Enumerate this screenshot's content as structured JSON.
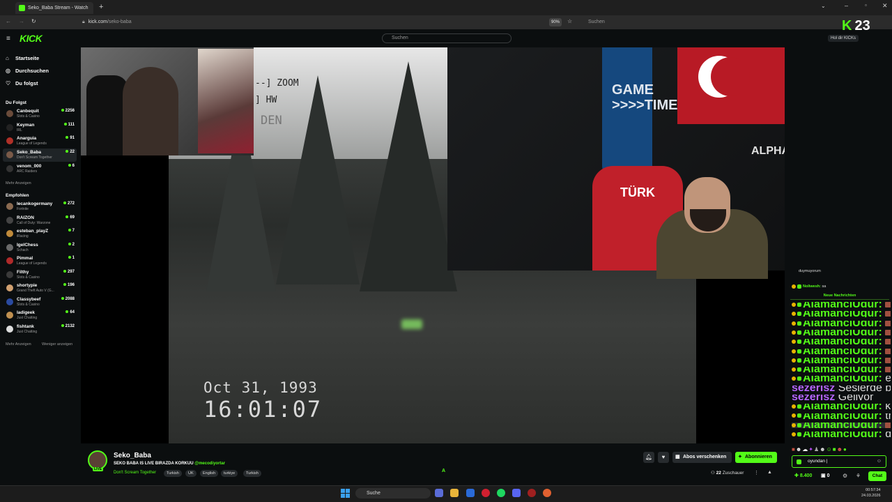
{
  "browser": {
    "tab_title": "Seko_Baba Stream - Watch",
    "url_host": "kick.com",
    "url_path": "/seko-baba",
    "zoom": "90%",
    "search_placeholder": "Suchen"
  },
  "header": {
    "logo": "KICK",
    "search_placeholder": "Suchen",
    "kick_count": "23",
    "kick_letter": "K",
    "hold_kicks": "Hol dir KICKs"
  },
  "sidebar": {
    "nav": [
      {
        "label": "Startseite",
        "icon": "home-icon"
      },
      {
        "label": "Durchsuchen",
        "icon": "compass-icon"
      },
      {
        "label": "Du folgst",
        "icon": "heart-icon"
      }
    ],
    "following_title": "Du Folgst",
    "following": [
      {
        "name": "Canbequit",
        "game": "Slots & Casino",
        "viewers": "2256"
      },
      {
        "name": "Keyman",
        "game": "IRL",
        "viewers": "111"
      },
      {
        "name": "Anarguia",
        "game": "League of Legends",
        "viewers": "91"
      },
      {
        "name": "Seko_Baba",
        "game": "Don't Scream Together",
        "viewers": "22"
      },
      {
        "name": "venom_000",
        "game": "ARC Raiders",
        "viewers": "6"
      }
    ],
    "more_label": "Mehr Anzeigen",
    "recommended_title": "Empfohlen",
    "recommended": [
      {
        "name": "lecankogermany",
        "game": "Fortnite",
        "viewers": "272"
      },
      {
        "name": "RAIZON",
        "game": "Call of Duty: Warzone",
        "viewers": "69"
      },
      {
        "name": "esteban_playZ",
        "game": "iRacing",
        "viewers": "7"
      },
      {
        "name": "IgelChess",
        "game": "Schach",
        "viewers": "2"
      },
      {
        "name": "Pimmal",
        "game": "League of Legends",
        "viewers": "1"
      },
      {
        "name": "Filthy",
        "game": "Slots & Casino",
        "viewers": "297"
      },
      {
        "name": "shortypie",
        "game": "Grand Theft Auto V (G...",
        "viewers": "196"
      },
      {
        "name": "Classybeef",
        "game": "Slots & Casino",
        "viewers": "2088"
      },
      {
        "name": "ladigeek",
        "game": "Just Chatting",
        "viewers": "64"
      },
      {
        "name": "fishtank",
        "game": "Just Chatting",
        "viewers": "2132"
      }
    ],
    "more_label2": "Mehr Anzeigen",
    "less_label": "Weniger anzeigen"
  },
  "video": {
    "vhs_date": "Oct 31, 1993",
    "vhs_time": "16:01:07",
    "vhs_zoom": "--] ZOOM",
    "vhs_hw": "] HW",
    "vhs_den": "DEN",
    "neon_sign": "GAME\n>>>>TIME",
    "wall_sign": "ALPHAWOLF_TTV",
    "shirt_text": "TÜRK"
  },
  "chat": {
    "top_messages": [
      {
        "user": "",
        "text": "duymuyorum"
      },
      {
        "user": "Noliwesh:",
        "text": "sa"
      }
    ],
    "new_messages_label": "Neue Nachrichten",
    "messages": [
      {
        "user": "AlamancıUgur:",
        "text": "",
        "emote": true
      },
      {
        "user": "AlamancıUgur:",
        "text": "",
        "emote": true
      },
      {
        "user": "AlamancıUgur:",
        "text": "",
        "emote": true
      },
      {
        "user": "AlamancıUgur:",
        "text": "",
        "emote": true
      },
      {
        "user": "AlamancıUgur:",
        "text": "",
        "emote": true
      },
      {
        "user": "AlamancıUgur:",
        "text": "",
        "emote": true
      },
      {
        "user": "AlamancıUgur:",
        "text": "",
        "emote": true
      },
      {
        "user": "AlamancıUgur:",
        "text": "",
        "emote": true
      },
      {
        "user": "AlamancıUgur:",
        "text": "evt geliyo",
        "emote": false
      },
      {
        "user": "sezerlsz",
        "text": "Seslerde problem yok",
        "emote": false
      },
      {
        "user": "sezerlsz",
        "text": "Geliyor",
        "emote": false
      },
      {
        "user": "AlamancıUgur:",
        "text": "kimin dc",
        "emote": false
      },
      {
        "user": "AlamancıUgur:",
        "text": "tmm",
        "emote": false
      },
      {
        "user": "AlamancıUgur:",
        "text": "",
        "emote": true
      },
      {
        "user": "AlamancıUgur:",
        "text": "dc gelirsin",
        "emote": false
      }
    ],
    "input_value": "oyundan |",
    "points": "8.400",
    "zero": "0",
    "chat_button": "Chat"
  },
  "stream": {
    "streamer": "Seko_Baba",
    "live": "LIVE",
    "title": "SEKO BABA IS LIVE BIRAZDA KORKUU",
    "mention": "@mecodiyortar",
    "category": "Don't Scream Together",
    "tags": [
      "Turkish",
      "UK",
      "English",
      "turkiye",
      "Turkish"
    ],
    "gift_label": "Abos verschenken",
    "subscribe_label": "Abonnieren",
    "viewers": "22",
    "viewers_label": "Zuschauer",
    "center_icon": "A"
  },
  "taskbar": {
    "search": "Suche",
    "time": "00:57:34",
    "date": "24.03.2026"
  },
  "colors": {
    "accent": "#53fc18",
    "bg": "#0b0e0f"
  }
}
